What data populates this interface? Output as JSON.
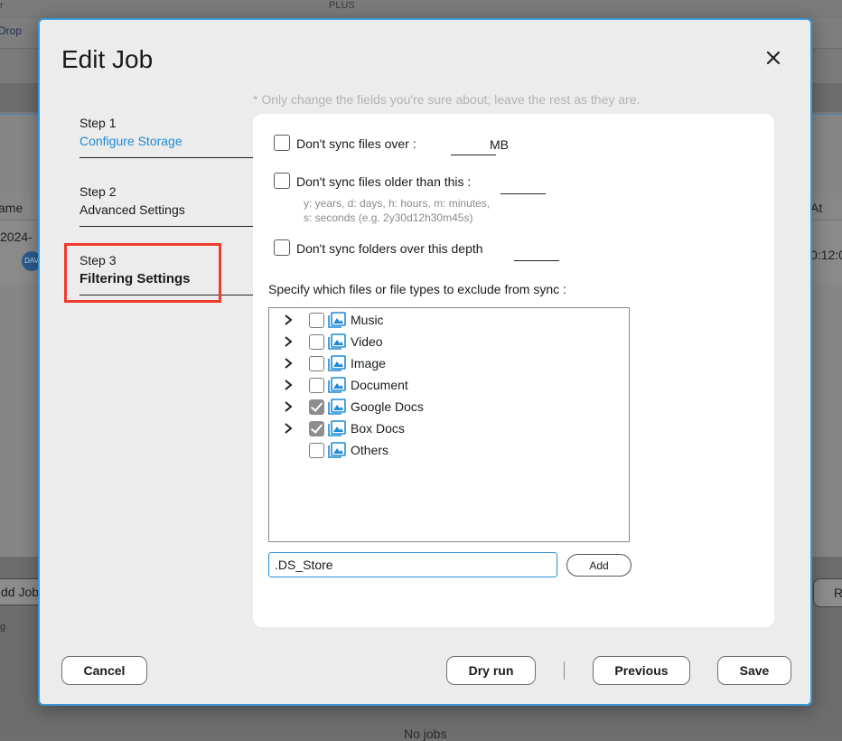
{
  "background": {
    "top_left": "r",
    "top_center": "PLUS",
    "drop_tab": "Drop",
    "col_name": "ame",
    "col_at": "At",
    "row_date": "2024-",
    "row_time": "0:12:0",
    "row_avatar": "DAV",
    "add_job": "dd Job",
    "right_btn": "R",
    "log": "g",
    "no_jobs": "No jobs"
  },
  "dialog": {
    "title": "Edit Job",
    "note": "* Only change the fields you're sure about; leave the rest as they are."
  },
  "steps": [
    {
      "num": "Step 1",
      "name": "Configure Storage"
    },
    {
      "num": "Step 2",
      "name": "Advanced Settings"
    },
    {
      "num": "Step 3",
      "name": "Filtering Settings"
    }
  ],
  "options": {
    "size": {
      "label": "Don't sync files over :",
      "unit": "MB",
      "value": ""
    },
    "age": {
      "label": "Don't sync files older than this :",
      "value": "",
      "hint1": "y: years, d: days, h: hours, m: minutes,",
      "hint2": "s: seconds (e.g. 2y30d12h30m45s)"
    },
    "depth": {
      "label": "Don't sync folders over this depth",
      "value": ""
    }
  },
  "exclude": {
    "label": "Specify which files or file types to exclude from sync :",
    "items": [
      {
        "label": "Music",
        "checked": false,
        "expandable": true
      },
      {
        "label": "Video",
        "checked": false,
        "expandable": true
      },
      {
        "label": "Image",
        "checked": false,
        "expandable": true
      },
      {
        "label": "Document",
        "checked": false,
        "expandable": true
      },
      {
        "label": "Google Docs",
        "checked": true,
        "expandable": true
      },
      {
        "label": "Box Docs",
        "checked": true,
        "expandable": true
      },
      {
        "label": "Others",
        "checked": false,
        "expandable": false
      }
    ],
    "pattern_value": ".DS_Store",
    "add_label": "Add"
  },
  "buttons": {
    "cancel": "Cancel",
    "dry_run": "Dry run",
    "previous": "Previous",
    "save": "Save"
  },
  "colors": {
    "accent": "#1e8ad6",
    "highlight": "#ef3b2d",
    "modal_border": "#3a97d6",
    "file_icon": "#1e8ad6"
  }
}
